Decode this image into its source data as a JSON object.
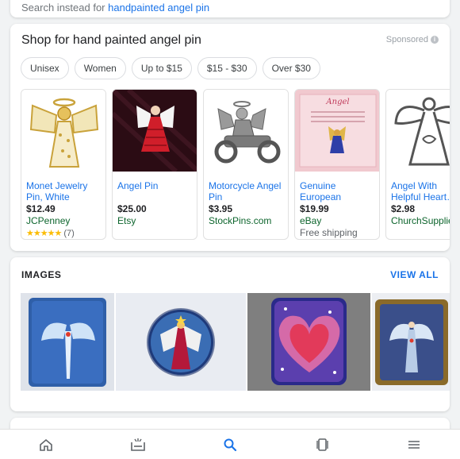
{
  "top": {
    "prefix": "Search instead for ",
    "link": "handpainted angel pin"
  },
  "shop": {
    "title": "Shop for hand painted angel pin",
    "sponsored": "Sponsored",
    "filters": [
      "Unisex",
      "Women",
      "Up to $15",
      "$15 - $30",
      "Over $30"
    ],
    "products": [
      {
        "name": "Monet Jewelry Pin, White (One…",
        "price": "$12.49",
        "store": "JCPenney",
        "stars": "★★★★★",
        "reviews": "(7)",
        "extra": ""
      },
      {
        "name": "Angel Pin",
        "price": "$25.00",
        "store": "Etsy",
        "stars": "",
        "reviews": "",
        "extra": ""
      },
      {
        "name": "Motorcycle Angel Pin",
        "price": "$3.95",
        "store": "StockPins.com",
        "stars": "",
        "reviews": "",
        "extra": ""
      },
      {
        "name": "Genuine European Crysta…",
        "price": "$19.99",
        "store": "eBay",
        "stars": "",
        "reviews": "",
        "extra": "Free shipping"
      },
      {
        "name": "Angel With Helpful Heart…",
        "price": "$2.98",
        "store": "ChurchSupplier.c",
        "stars": "",
        "reviews": "",
        "extra": ""
      }
    ]
  },
  "images": {
    "title": "IMAGES",
    "view_all": "VIEW ALL"
  },
  "nav": [
    "home-icon",
    "updates-icon",
    "search-icon",
    "tabs-icon",
    "menu-icon"
  ],
  "colors": {
    "link": "#1a73e8",
    "store": "#0d652d",
    "star": "#fbbc04"
  }
}
